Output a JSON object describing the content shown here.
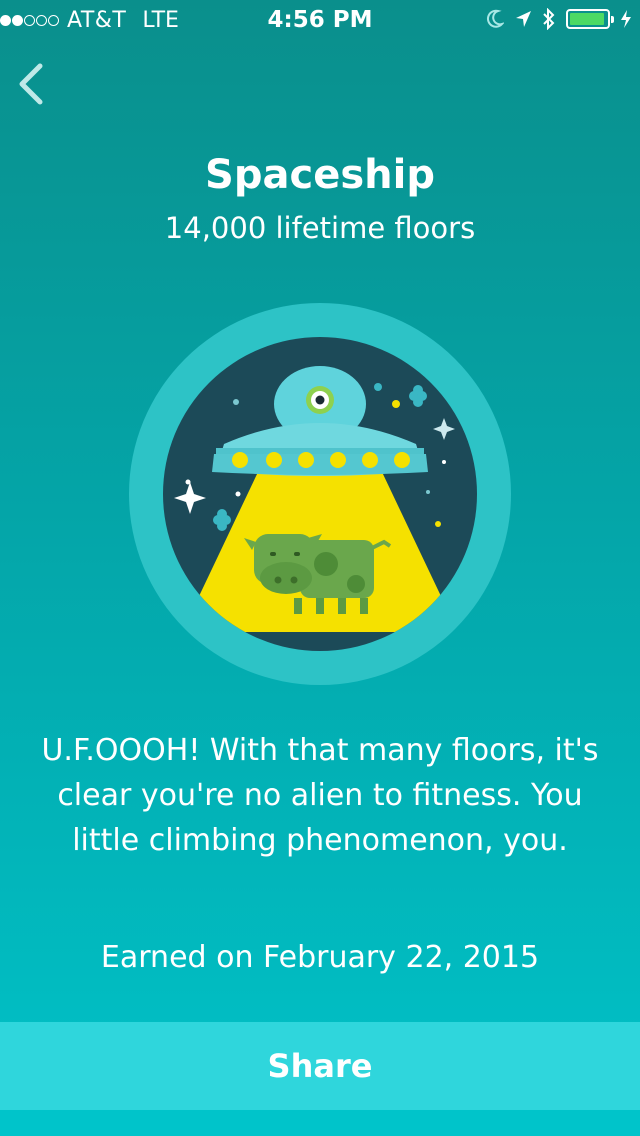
{
  "status_bar": {
    "carrier": "AT&T",
    "network": "LTE",
    "time": "4:56 PM",
    "signal_bars_filled": 2,
    "signal_bars_total": 5,
    "battery_color": "#4cd964"
  },
  "nav": {
    "back_icon": "chevron-left-icon"
  },
  "badge": {
    "title": "Spaceship",
    "subtitle": "14,000 lifetime floors",
    "icon": "ufo-cow-badge",
    "message": "U.F.OOOH! With that many floors, it's clear you're no alien to fitness. You little climbing phenomenon, you.",
    "earned": "Earned on February 22, 2015"
  },
  "actions": {
    "share_label": "Share"
  },
  "colors": {
    "background_top": "#0a8f8c",
    "background_bottom": "#00c2c8",
    "share_bg": "#2fd6dc",
    "beam_yellow": "#f5e100",
    "ufo_teal": "#5fd3dc"
  }
}
